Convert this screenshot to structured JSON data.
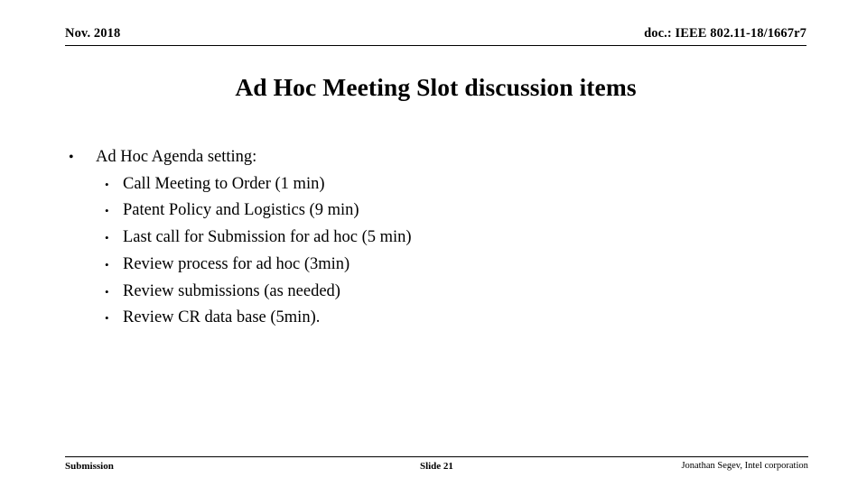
{
  "header": {
    "left": "Nov. 2018",
    "right": "doc.: IEEE 802.11-18/1667r7"
  },
  "title": "Ad Hoc Meeting Slot discussion items",
  "bullet_glyph": "•",
  "body": {
    "items": [
      {
        "level": 1,
        "text": "Ad Hoc Agenda setting:"
      },
      {
        "level": 2,
        "text": "Call Meeting to Order (1 min)"
      },
      {
        "level": 2,
        "text": "Patent Policy and Logistics (9 min)"
      },
      {
        "level": 2,
        "text": "Last call for Submission for ad hoc (5 min)"
      },
      {
        "level": 2,
        "text": "Review process for ad hoc (3min)"
      },
      {
        "level": 2,
        "text": "Review submissions (as needed)"
      },
      {
        "level": 2,
        "text": "Review CR data base (5min)."
      }
    ]
  },
  "footer": {
    "left": "Submission",
    "center": "Slide 21",
    "right": "Jonathan Segev, Intel corporation"
  },
  "colors": {
    "text": "#000000",
    "background": "#ffffff",
    "rule": "#000000"
  }
}
